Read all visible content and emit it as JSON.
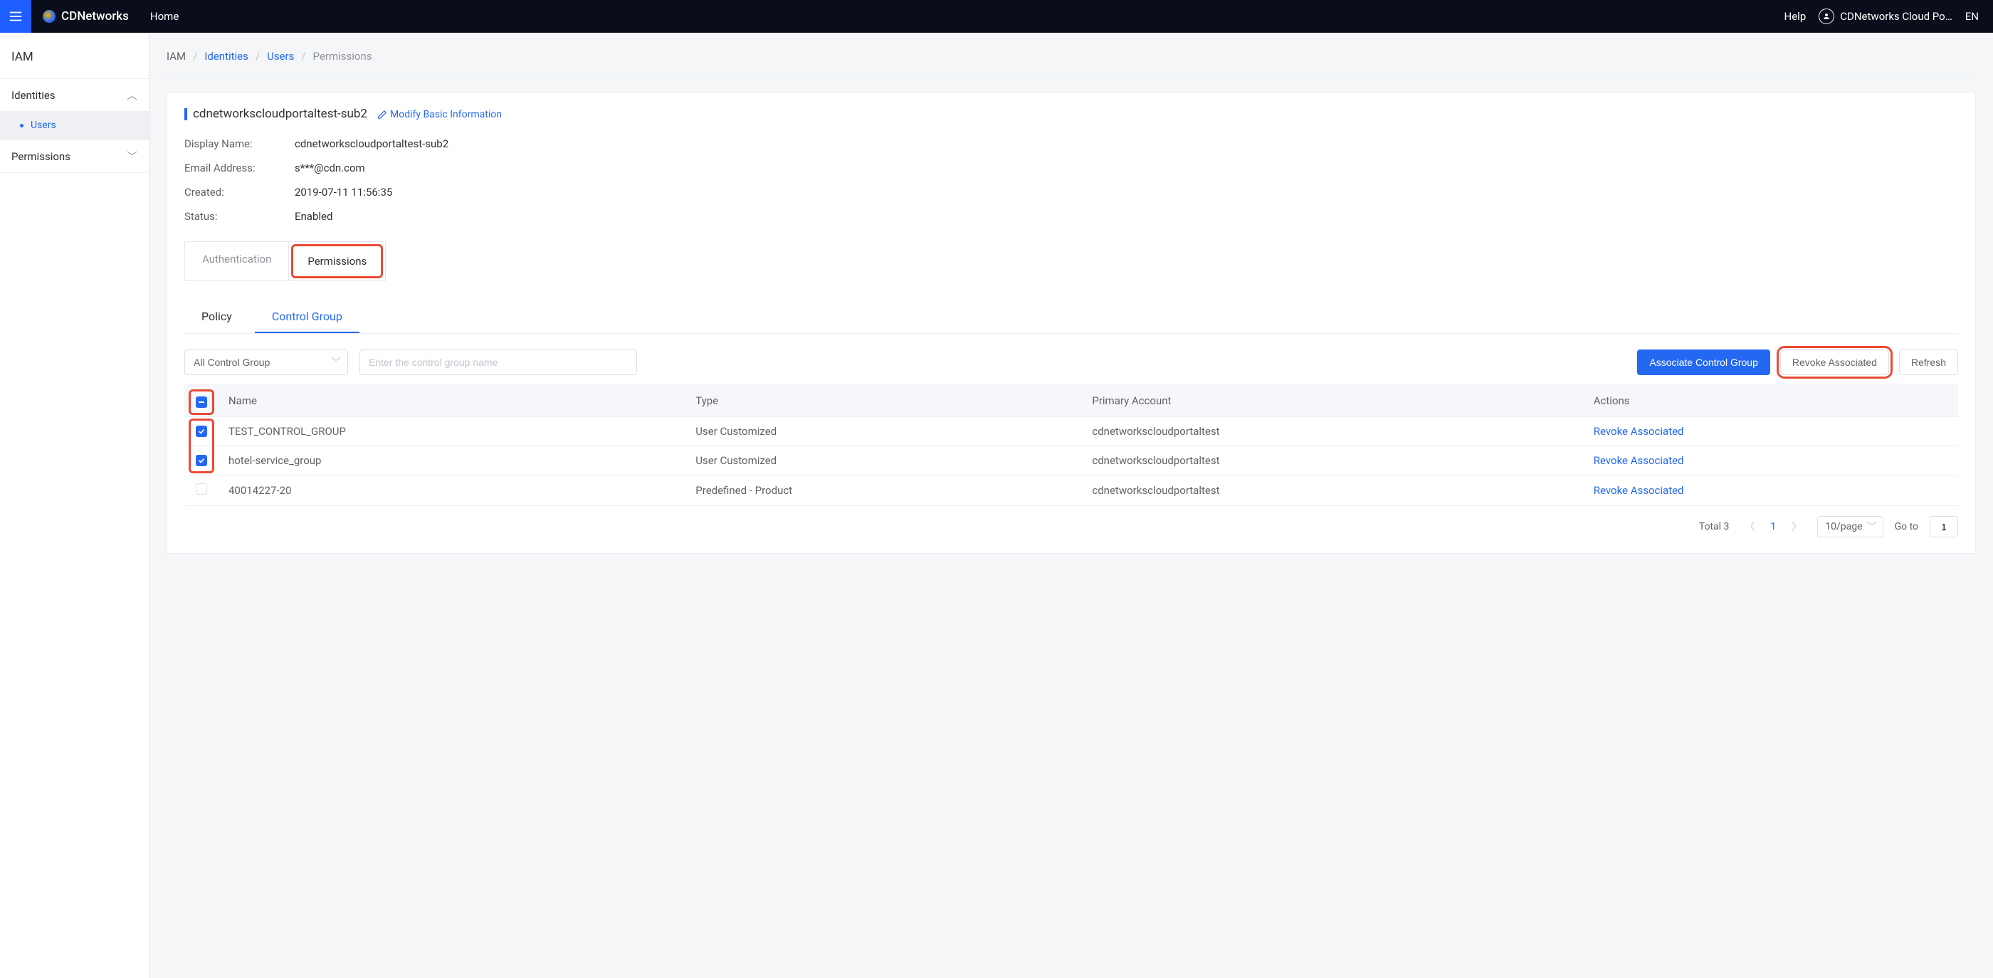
{
  "header": {
    "brand": "CDNetworks",
    "home": "Home",
    "help": "Help",
    "user": "CDNetworks Cloud Po…",
    "lang": "EN"
  },
  "sidebar": {
    "title": "IAM",
    "identities_label": "Identities",
    "users_label": "Users",
    "permissions_label": "Permissions"
  },
  "breadcrumb": {
    "root": "IAM",
    "identities": "Identities",
    "users": "Users",
    "permissions": "Permissions"
  },
  "user": {
    "title": "cdnetworkscloudportaltest-sub2",
    "modify": "Modify Basic Information",
    "display_name_label": "Display Name:",
    "display_name": "cdnetworkscloudportaltest-sub2",
    "email_label": "Email Address:",
    "email": "s***@cdn.com",
    "created_label": "Created:",
    "created": "2019-07-11 11:56:35",
    "status_label": "Status:",
    "status": "Enabled"
  },
  "ptabs": {
    "auth": "Authentication",
    "perm": "Permissions"
  },
  "subtabs": {
    "policy": "Policy",
    "cg": "Control Group"
  },
  "toolbar": {
    "filter_value": "All Control Group",
    "search_placeholder": "Enter the control group name",
    "assoc_btn": "Associate Control Group",
    "revoke_btn": "Revoke Associated",
    "refresh_btn": "Refresh"
  },
  "table": {
    "cols": {
      "name": "Name",
      "type": "Type",
      "primary": "Primary Account",
      "actions": "Actions"
    },
    "rows": [
      {
        "checked": true,
        "name": "TEST_CONTROL_GROUP",
        "type": "User Customized",
        "primary": "cdnetworkscloudportaltest",
        "action": "Revoke Associated"
      },
      {
        "checked": true,
        "name": "hotel-service_group",
        "type": "User Customized",
        "primary": "cdnetworkscloudportaltest",
        "action": "Revoke Associated"
      },
      {
        "checked": false,
        "name": "40014227-20",
        "type": "Predefined - Product",
        "primary": "cdnetworkscloudportaltest",
        "action": "Revoke Associated"
      }
    ]
  },
  "pager": {
    "total_label": "Total 3",
    "current": "1",
    "perpage": "10/page",
    "goto_label": "Go to",
    "goto_value": "1"
  }
}
